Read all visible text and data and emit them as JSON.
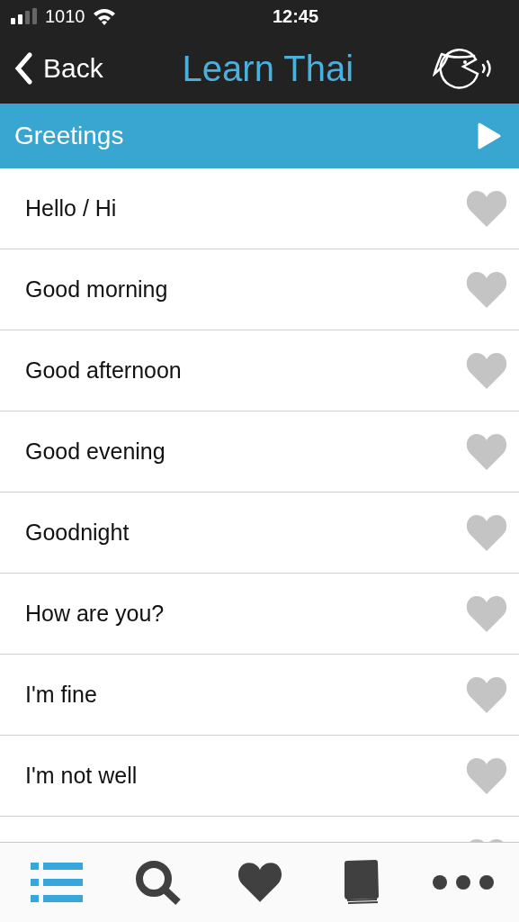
{
  "status_bar": {
    "carrier": "1010",
    "time": "12:45"
  },
  "nav": {
    "back": "Back",
    "title": "Learn Thai"
  },
  "section": {
    "title": "Greetings"
  },
  "phrases": [
    {
      "text": "Hello / Hi",
      "favorite": false
    },
    {
      "text": "Good morning",
      "favorite": false
    },
    {
      "text": "Good afternoon",
      "favorite": false
    },
    {
      "text": "Good evening",
      "favorite": false
    },
    {
      "text": "Goodnight",
      "favorite": false
    },
    {
      "text": "How are you?",
      "favorite": false
    },
    {
      "text": "I'm fine",
      "favorite": false
    },
    {
      "text": "I'm not well",
      "favorite": false
    }
  ],
  "tab_bar": [
    {
      "kind": "list",
      "selected": true
    },
    {
      "kind": "search",
      "selected": false
    },
    {
      "kind": "favorites",
      "selected": false
    },
    {
      "kind": "dictionary",
      "selected": false
    },
    {
      "kind": "more",
      "selected": false
    }
  ]
}
